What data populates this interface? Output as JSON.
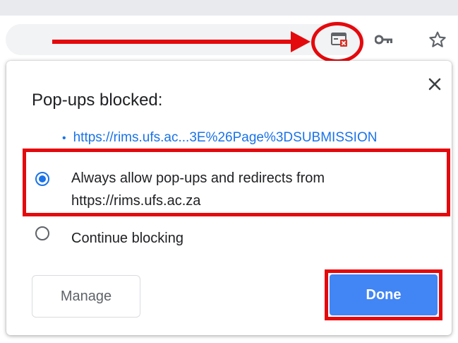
{
  "toolbar": {
    "icons": [
      "popup-blocked-icon",
      "key-icon",
      "star-icon"
    ]
  },
  "dialog": {
    "title": "Pop-ups blocked:",
    "close_label": "×",
    "blocked_link": "https://rims.ufs.ac...3E%26Page%3DSUBMISSION",
    "options": [
      {
        "label": "Always allow pop-ups and redirects from https://rims.ufs.ac.za",
        "selected": true
      },
      {
        "label": "Continue blocking",
        "selected": false
      }
    ],
    "manage_label": "Manage",
    "done_label": "Done"
  },
  "colors": {
    "accent": "#1a73e8",
    "done_button": "#4285f4",
    "annotation": "#e4090d"
  }
}
